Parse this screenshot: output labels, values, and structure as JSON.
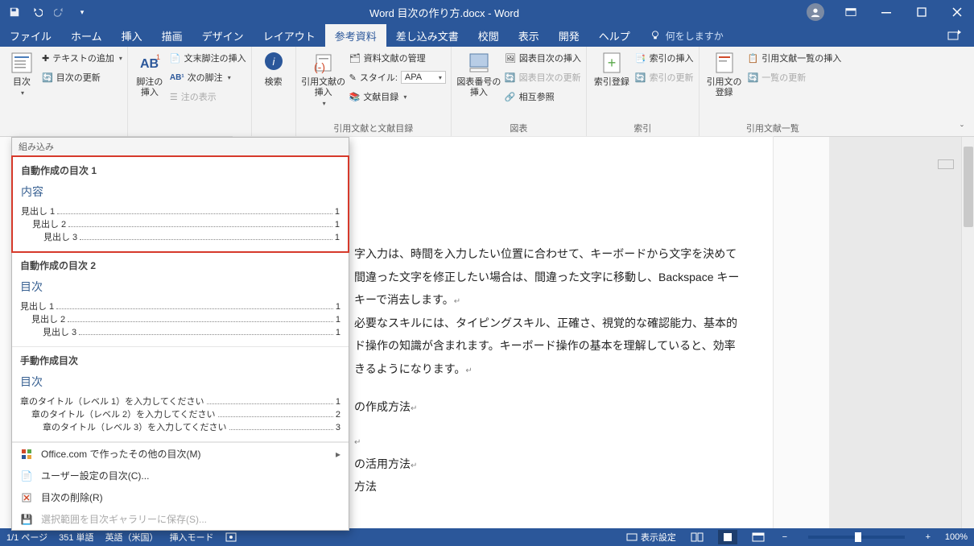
{
  "titlebar": {
    "doc_title": "Word 目次の作り方.docx - Word"
  },
  "menubar": {
    "tabs": [
      "ファイル",
      "ホーム",
      "挿入",
      "描画",
      "デザイン",
      "レイアウト",
      "参考資料",
      "差し込み文書",
      "校閲",
      "表示",
      "開発",
      "ヘルプ"
    ],
    "active_index": 6,
    "tellme": "何をしますか"
  },
  "ribbon": {
    "toc": {
      "btn": "目次",
      "add_text": "テキストの追加",
      "update": "目次の更新"
    },
    "footnote": {
      "insert": "脚注の挿入",
      "endnote": "文末脚注の挿入",
      "next": "次の脚注",
      "show": "注の表示"
    },
    "search": {
      "btn": "検索"
    },
    "citations": {
      "insert": "引用文献の挿入",
      "manage": "資料文献の管理",
      "style_label": "スタイル:",
      "style_value": "APA",
      "bibliography": "文献目録",
      "group": "引用文献と文献目録"
    },
    "figures": {
      "insert_caption": "図表番号の挿入",
      "insert_tof": "図表目次の挿入",
      "update_tof": "図表目次の更新",
      "crossref": "相互参照",
      "group": "図表"
    },
    "index": {
      "mark": "索引登録",
      "insert": "索引の挿入",
      "update": "索引の更新",
      "group": "索引"
    },
    "authorities": {
      "mark": "引用文の登録",
      "insert": "引用文献一覧の挿入",
      "update": "一覧の更新",
      "group": "引用文献一覧"
    }
  },
  "toc_dropdown": {
    "builtin_header": "組み込み",
    "presets": [
      {
        "title": "自動作成の目次 1",
        "inner": "内容",
        "entries": [
          {
            "l": 1,
            "t": "見出し 1",
            "p": "1"
          },
          {
            "l": 2,
            "t": "見出し 2",
            "p": "1"
          },
          {
            "l": 3,
            "t": "見出し 3",
            "p": "1"
          }
        ],
        "highlight": true
      },
      {
        "title": "自動作成の目次 2",
        "inner": "目次",
        "entries": [
          {
            "l": 1,
            "t": "見出し 1",
            "p": "1"
          },
          {
            "l": 2,
            "t": "見出し 2",
            "p": "1"
          },
          {
            "l": 3,
            "t": "見出し 3",
            "p": "1"
          }
        ]
      },
      {
        "title": "手動作成目次",
        "inner": "目次",
        "entries": [
          {
            "l": 1,
            "t": "章のタイトル（レベル 1）を入力してください",
            "p": "1"
          },
          {
            "l": 2,
            "t": "章のタイトル（レベル 2）を入力してください",
            "p": "2"
          },
          {
            "l": 3,
            "t": "章のタイトル（レベル 3）を入力してください",
            "p": "3"
          }
        ]
      }
    ],
    "more_office": "Office.com で作ったその他の目次(M)",
    "custom": "ユーザー設定の目次(C)...",
    "remove": "目次の削除(R)",
    "save_gallery": "選択範囲を目次ギャラリーに保存(S)..."
  },
  "document": {
    "p1": "字入力は、時間を入力したい位置に合わせて、キーボードから文字を決めて",
    "p2": "間違った文字を修正したい場合は、間違った文字に移動し、Backspace キー",
    "p3": "キーで消去します。",
    "p4": "必要なスキルには、タイピングスキル、正確さ、視覚的な確認能力、基本的",
    "p5": "ド操作の知識が含まれます。キーボード操作の基本を理解していると、効率",
    "p6": "きるようになります。",
    "p7": "の作成方法",
    "p8": "の活用方法",
    "p9": "方法"
  },
  "statusbar": {
    "page": "1/1 ページ",
    "words": "351 単語",
    "lang": "英語（米国）",
    "insert": "挿入モード",
    "display_settings": "表示設定",
    "zoom": "100%"
  }
}
